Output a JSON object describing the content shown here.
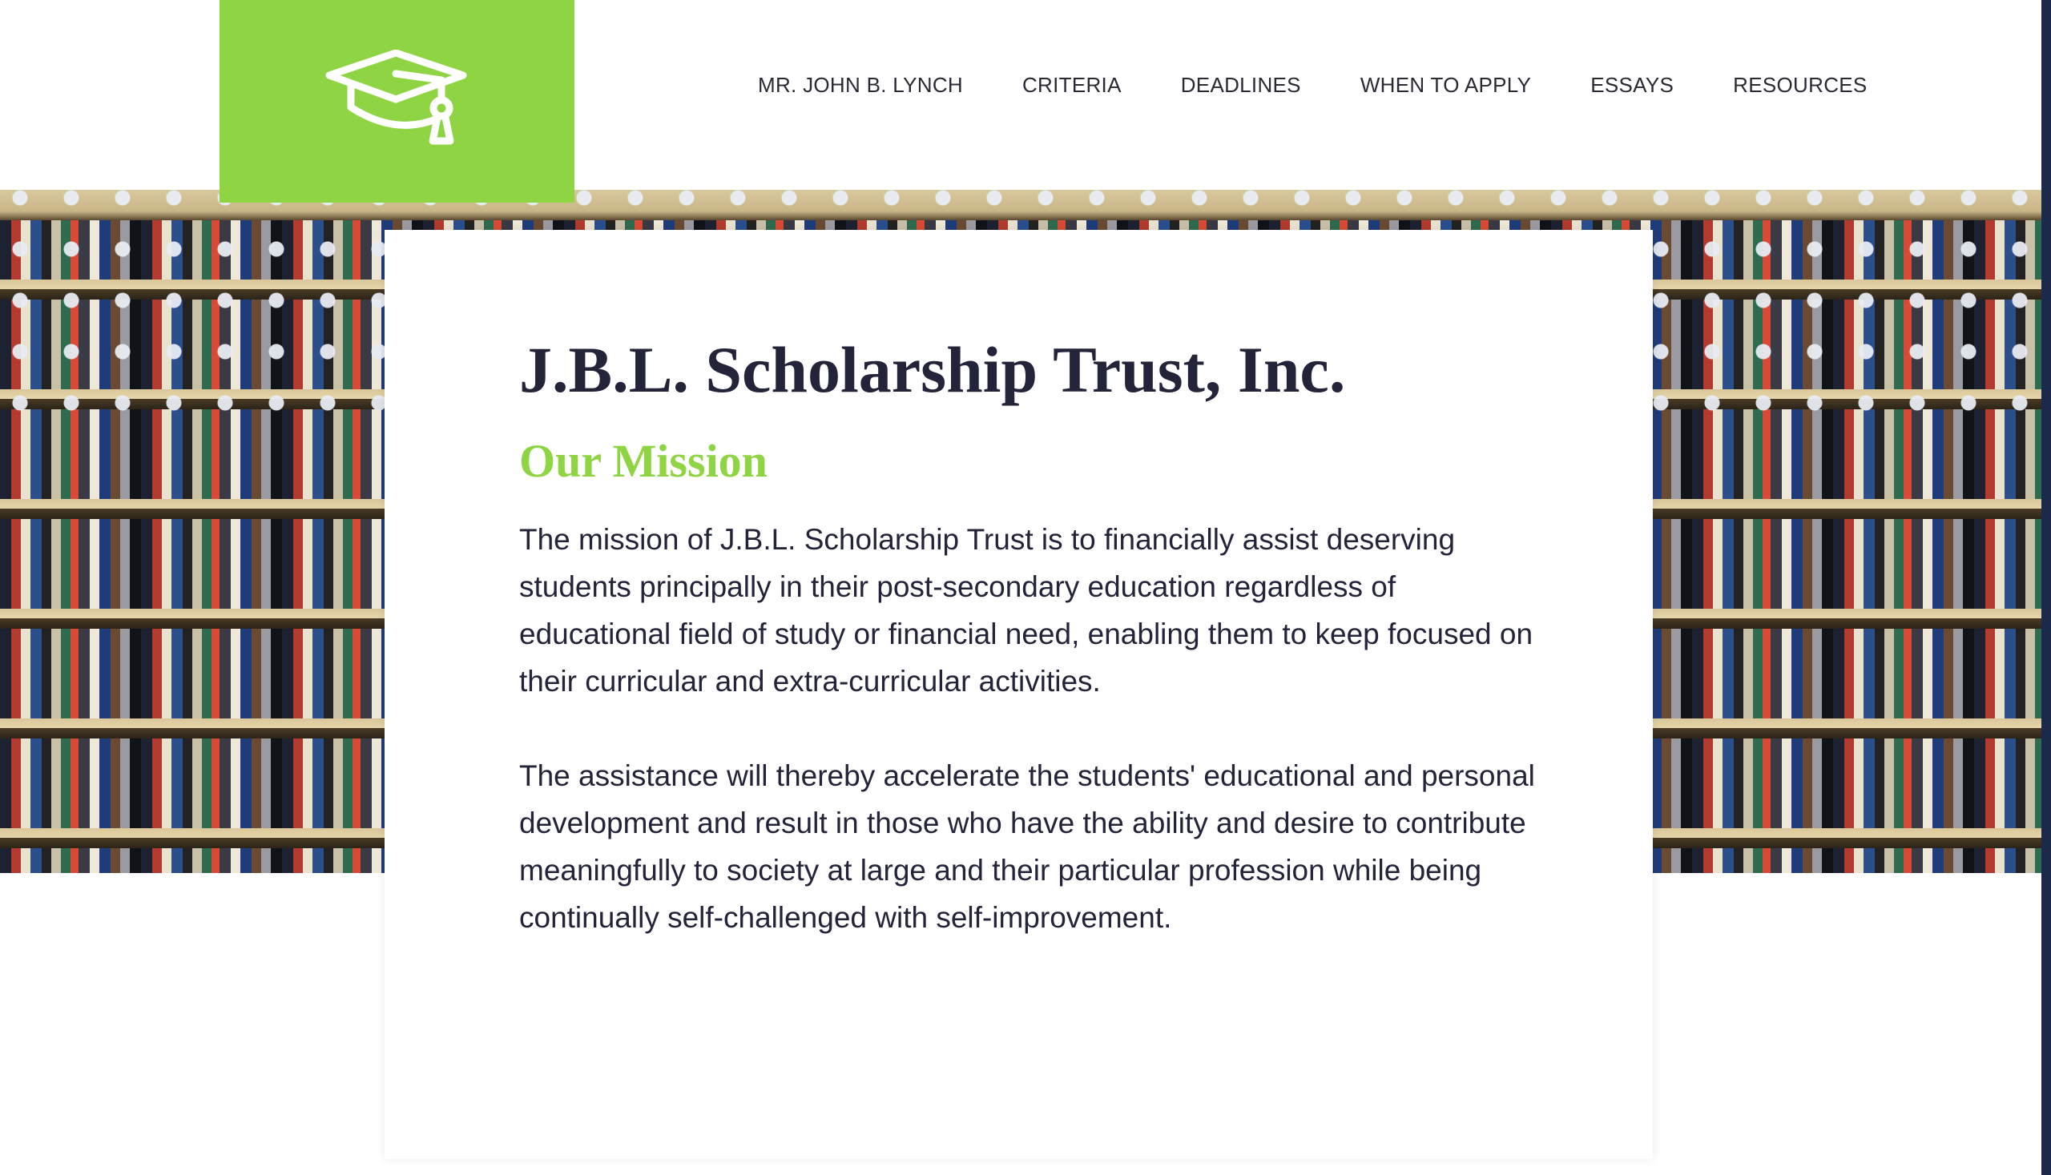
{
  "header": {
    "logo_icon": "graduation-cap-icon",
    "brand_color": "#8fd443",
    "nav": [
      {
        "label": "MR. JOHN B. LYNCH"
      },
      {
        "label": "CRITERIA"
      },
      {
        "label": "DEADLINES"
      },
      {
        "label": "WHEN TO APPLY"
      },
      {
        "label": "ESSAYS"
      },
      {
        "label": "RESOURCES"
      }
    ]
  },
  "main": {
    "title": "J.B.L. Scholarship Trust, Inc.",
    "subtitle": "Our Mission",
    "paragraphs": [
      "The mission of J.B.L. Scholarship Trust is to financially assist deserving students principally in their post-secondary education regardless of educational field of study or financial need, enabling them to keep focused on their curricular and extra-curricular activities.",
      "The assistance will thereby accelerate the students' educational and personal development and result in those who have the ability and desire to contribute meaningfully to society at large and their particular profession while being continually self-challenged with self-improvement."
    ]
  },
  "colors": {
    "title": "#23233a",
    "accent": "#8fd443"
  }
}
